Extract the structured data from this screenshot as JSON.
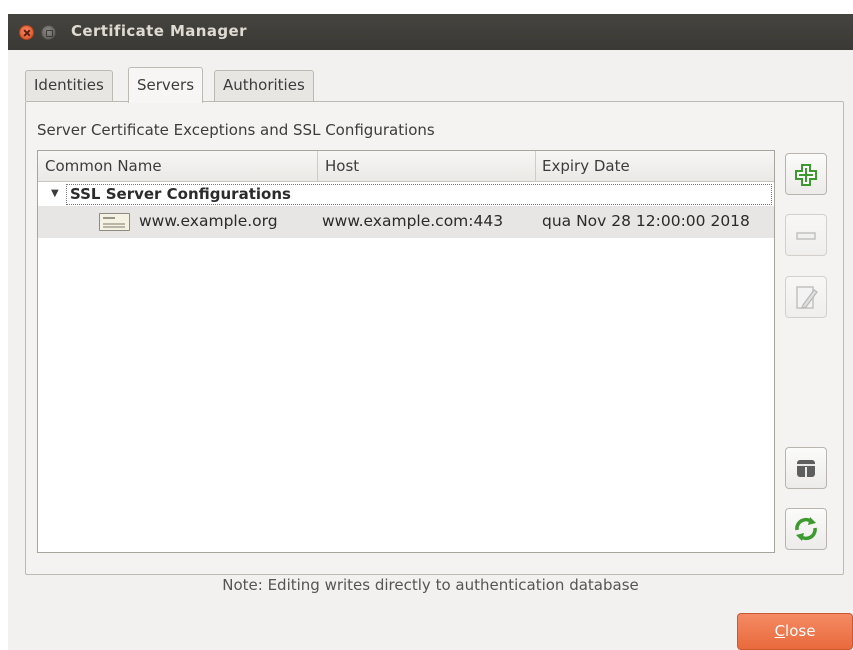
{
  "window": {
    "title": "Certificate Manager"
  },
  "tabs": [
    {
      "label": "Identities",
      "active": false
    },
    {
      "label": "Servers",
      "active": true
    },
    {
      "label": "Authorities",
      "active": false
    }
  ],
  "group": {
    "title": "Server Certificate Exceptions and SSL Configurations"
  },
  "tree": {
    "columns": [
      "Common Name",
      "Host",
      "Expiry Date"
    ],
    "parent": {
      "label": "SSL Server Configurations",
      "expanded": true
    },
    "rows": [
      {
        "common_name": "www.example.org",
        "host": "www.example.com:443",
        "expiry": "qua Nov 28 12:00:00 2018"
      }
    ]
  },
  "side_buttons": [
    {
      "name": "add-icon",
      "enabled": true
    },
    {
      "name": "remove-icon",
      "enabled": false
    },
    {
      "name": "edit-icon",
      "enabled": false
    },
    {
      "name": "database-icon",
      "enabled": true
    },
    {
      "name": "refresh-icon",
      "enabled": true
    }
  ],
  "note": "Note: Editing writes directly to authentication database",
  "footer": {
    "close_label_first": "C",
    "close_label_rest": "lose"
  },
  "colors": {
    "accent": "#e96a3c",
    "titlebar": "#3c3b37",
    "add_green": "#3d9a2f"
  }
}
